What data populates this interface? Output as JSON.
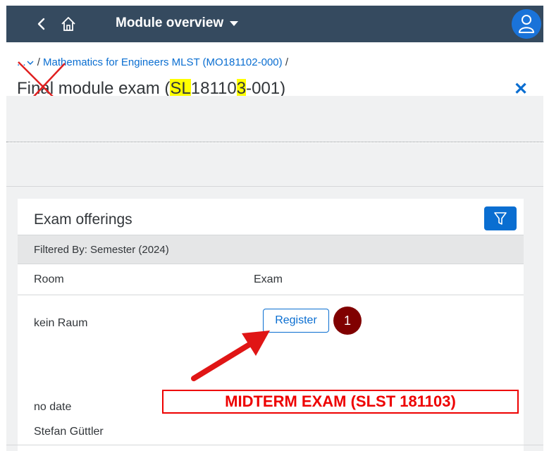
{
  "shellbar": {
    "title": "Module overview",
    "icons": [
      "back-icon",
      "home-icon",
      "user-avatar-icon"
    ]
  },
  "header": {
    "breadcrumb_ellipsis": "...",
    "breadcrumb_item": "Mathematics for Engineers MLST (MO181102-000)",
    "breadcrumb_sep": "/",
    "title_part1": "Final module exam (",
    "title_hl1": "SL",
    "title_part2": "18110",
    "title_hl2": "3",
    "title_part3": "-001)",
    "close_symbol": "✕"
  },
  "panel": {
    "title": "Exam offerings",
    "filter_text": "Filtered By: Semester (2024)",
    "columns": [
      "Room",
      "Exam"
    ],
    "row": {
      "room": "kein Raum",
      "register_label": "Register",
      "date": "no date",
      "person": "Stefan Güttler"
    }
  },
  "annotations": {
    "badge_number": "1",
    "midterm_label": "MIDTERM EXAM (SLST 181103)"
  },
  "colors": {
    "shellbar": "#354a5f",
    "accent": "#0a6ed1",
    "highlight": "#ffff00",
    "annotation_red": "#ee0000",
    "badge": "#800000"
  }
}
